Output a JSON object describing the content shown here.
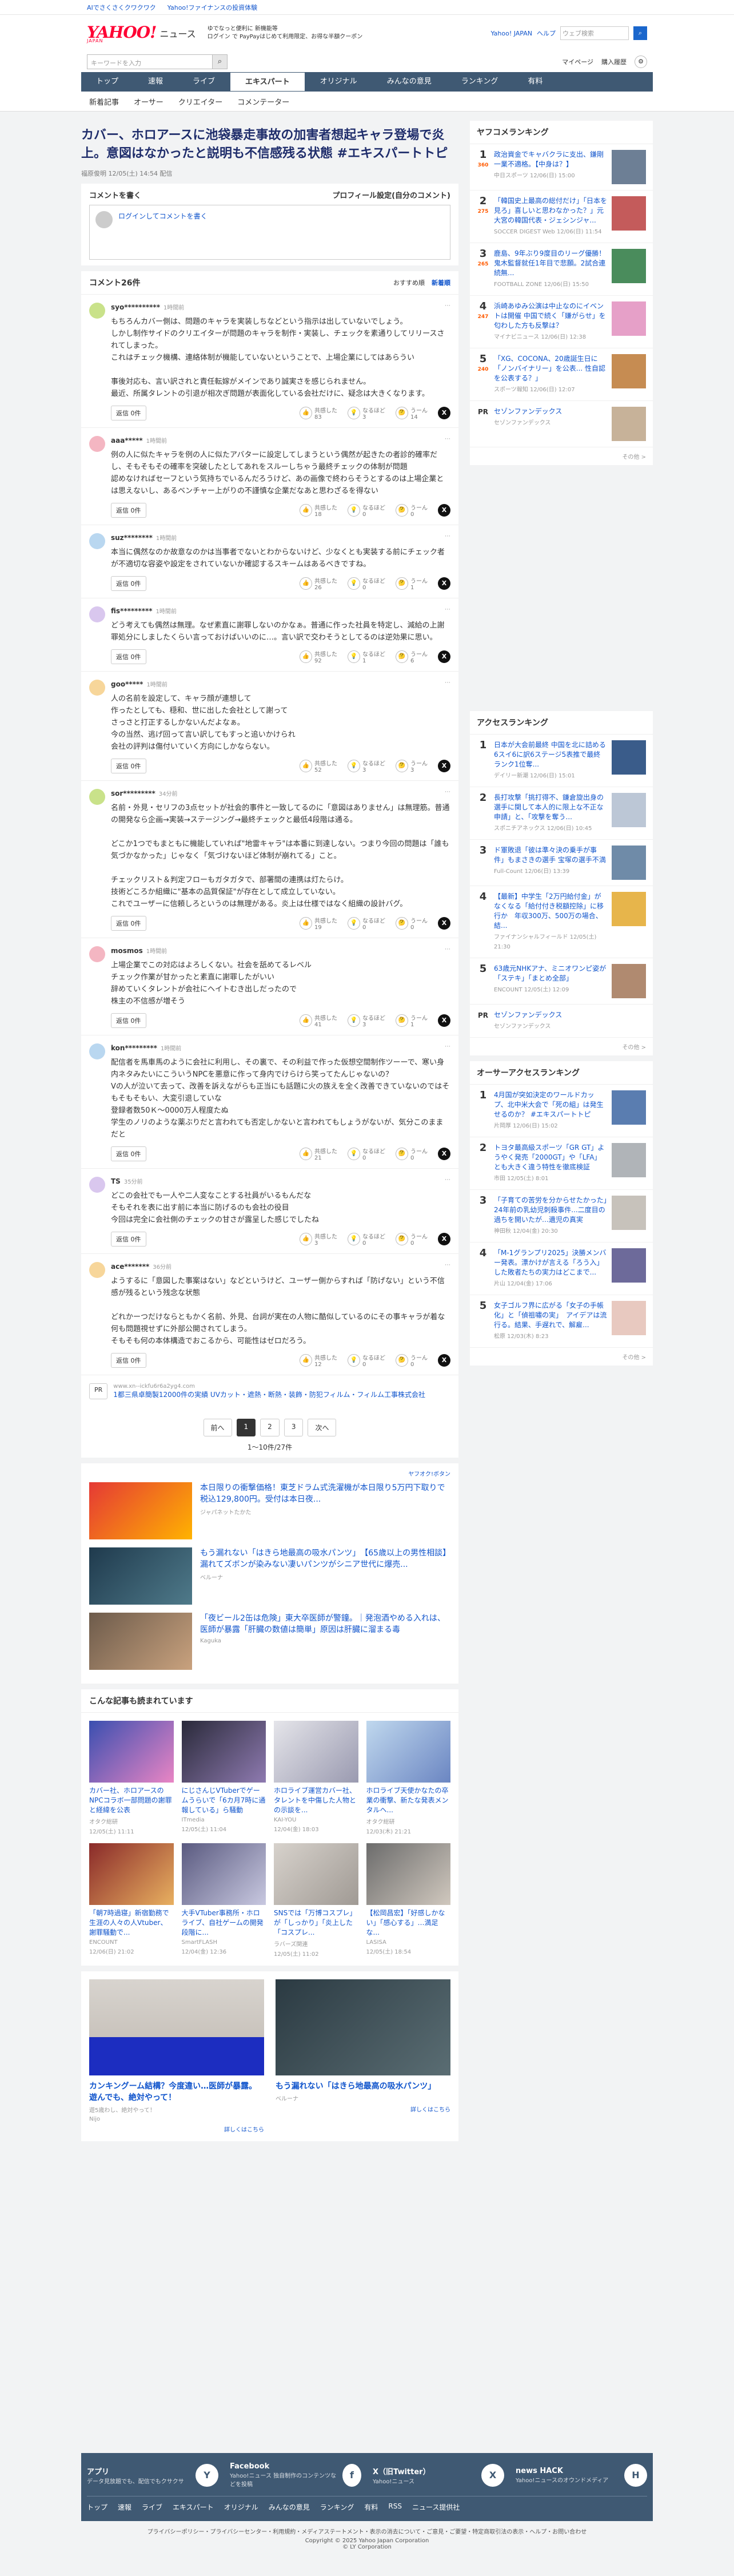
{
  "promo": [
    "AIでさくさくクワクワク",
    "Yahoo!ファイナンスの投資体験"
  ],
  "header": {
    "logo": "YAHOO!",
    "logo_sub": "JAPAN",
    "service": "ニュース",
    "promo_line1": "ゆでなっと便利に 新機能等",
    "promo_line2": "ログイン で PayPayはじめて利用限定、お得な半額クーポン",
    "links": [
      "Yahoo! JAPAN",
      "ヘルプ"
    ],
    "search_placeholder": "ウェブ検索"
  },
  "searchbar": {
    "placeholder": "キーワードを入力",
    "right": [
      "マイページ",
      "購入履歴"
    ]
  },
  "nav": [
    "トップ",
    "速報",
    "ライブ",
    "エキスパート",
    "オリジナル",
    "みんなの意見",
    "ランキング",
    "有料"
  ],
  "nav_active": "エキスパート",
  "subnav": [
    "新着記事",
    "オーサー",
    "クリエイター",
    "コメンテーター"
  ],
  "article": {
    "title": "カバー、ホロアースに池袋暴走事故の加害者想起キャラ登場で炎上。意図はなかったと説明も不信感残る状態 #エキスパートトピ",
    "meta": "福原俊明 12/05(土) 14:54 配信"
  },
  "comment_write": {
    "title": "コメントを書く",
    "profile_link": "プロフィール設定(自分のコメント)",
    "placeholder": "ログインしてコメントを書く"
  },
  "comments_header": {
    "title": "コメント26件",
    "sort": [
      "おすすめ順",
      "新着順"
    ]
  },
  "comments": [
    {
      "user": "syo**********",
      "time": "1時間前",
      "text": "もちろんカバー側は、問題のキャラを実装しちなどという指示は出していないでしょう。\nしかし制作サイドのクリエイターが問題のキャラを制作・実装し、チェックを素通りしてリリースされてしまった。\nこれはチェック機構、連絡体制が機能していないということで、上場企業にしてはあらうい\n\n事後対応も、言い訳されと責任転嫁がメインであり誠実さを感じられません。\n最近、所属タレントの引退が相次ぎ問題が表面化している会社だけに、疑念は大きくなります。",
      "reply": "返信 0件",
      "r1": "共感した\n83",
      "r2": "なるほど\n3",
      "r3": "うーん\n14"
    },
    {
      "user": "aaa*****",
      "time": "1時間前",
      "text": "例の人に似たキャラを例の人に似たアバターに設定してしまうという偶然が起きたの者診的確率だし、そもそもその確率を突破したとしてあれをスルーしちゃう最終チェックの体制が問題\n認めなければセーフという気持ちでいるんだろうけど、あの画像で終わらそうとするのは上場企業とは思えないし、あるベンチャー上がりの不謹慎な企業だなあと思わざるを得ない",
      "reply": "返信 0件",
      "r1": "共感した\n18",
      "r2": "なるほど\n0",
      "r3": "うーん\n0"
    },
    {
      "user": "suz********",
      "time": "1時間前",
      "text": "本当に偶然なのか故意なのかは当事者でないとわからないけど、少なくとも実装する前にチェック者が不適切な容姿や設定をされていないか確認するスキームはあるべきですね。",
      "reply": "返信 0件",
      "r1": "共感した\n26",
      "r2": "なるほど\n0",
      "r3": "うーん\n1"
    },
    {
      "user": "fis*********",
      "time": "1時間前",
      "text": "どう考えても偶然は無理。なぜ素直に謝罪しないのかなぁ。普通に作った社員を特定し、減給の上謝罪処分にしましたくらい言っておけばいいのに…。言い訳で交わそうとしてるのは逆効果に思い。",
      "reply": "返信 0件",
      "r1": "共感した\n92",
      "r2": "なるほど\n1",
      "r3": "うーん\n6"
    },
    {
      "user": "goo*****",
      "time": "1時間前",
      "text": "人の名前を設定して、キャラ顔が連想して\n作ったとしても、穏和、世に出した会社として謝って\nさっさと打正するしかないんだよなぁ。\n今の当然、逃げ回って言い訳してもすっと追いかけられ\n会社の評判は傷付いていく方向にしかならない。",
      "reply": "返信 0件",
      "r1": "共感した\n52",
      "r2": "なるほど\n3",
      "r3": "うーん\n3"
    },
    {
      "user": "sor*********",
      "time": "34分前",
      "text": "名前・外見・セリフの3点セットが社会的事件と一致してるのに「意図はありません」は無理筋。普通の開発なら企画→実装→ステージング→最終チェックと最低4段階は通る。\n\nどこか1つでもまともに機能していれば\"地雷キャラ\"は本番に到達しない。つまり今回の問題は「誰も気づかなかった」じゃなく「気づけないほど体制が崩れてる」こと。\n\nチェックリスト＆判定フローもガタガタで、部署間の連携は灯たらけ。\n技術どころか組織に\"基本の品質保証\"が存在として成立していない。\nこれでユーザーに信頼しろというのは無理がある。炎上は仕様ではなく組織の設計バグ。",
      "reply": "返信 0件",
      "r1": "共感した\n19",
      "r2": "なるほど\n0",
      "r3": "うーん\n0"
    },
    {
      "user": "mosmos",
      "time": "1時間前",
      "text": "上場企業でこの対応はよろしくない。社会を舐めてるレベル\nチェック作業が甘かったと素直に謝罪したがいい\n辞めていくタレントが会社にヘイトむき出しだったので\n株主の不信感が増そう",
      "reply": "返信 0件",
      "r1": "共感した\n41",
      "r2": "なるほど\n3",
      "r3": "うーん\n1"
    },
    {
      "user": "kon*********",
      "time": "1時間前",
      "text": "配信者を馬車馬のように会社に利用し、その裏で、その利益で作った仮想空間制作ツーーで、寒い身内ネタみたいにこういうNPCを悪意に作って身内でけらけら笑ってたんじゃないの？\nVの人が泣いて去って、改善を訴えながらも正当にも話題に火の族えを全く改善できていないのではそもそもそもい、大変引退していな\n登録者数50Ｋ～0000万人程度たぬ\n学生のノリのような薬ぶりだと言われても否定しかないと言われてもしょうがないが、気分このままだと",
      "reply": "返信 0件",
      "r1": "共感した\n21",
      "r2": "なるほど\n0",
      "r3": "うーん\n0"
    },
    {
      "user": "TS",
      "time": "35分前",
      "text": "どこの会社でも一人や二人変なことする社員がいるもんだな\nそもそれを表に出す前に本当に防げるのも会社の役目\n今回は完全に会社側のチェックの甘さが露呈した感じでしたね",
      "reply": "返信 0件",
      "r1": "共感した\n3",
      "r2": "なるほど\n0",
      "r3": "うーん\n0"
    },
    {
      "user": "ace*******",
      "time": "36分前",
      "text": "ようするに「意図した事案はない」などというけど、ユーザー側からすれば「防げない」という不信感が残るという残念な状態\n\nどれかーつだけならともかく名前、外見、台詞が実在の人物に酷似しているのにその事キャラが着な何も問題視せずに外部公開されてしまう。\nそもそも何の本体構造でおこるから、可能性はゼロだろう。",
      "reply": "返信 0件",
      "r1": "共感した\n12",
      "r2": "なるほど\n0",
      "r3": "うーん\n0"
    }
  ],
  "inline_ad": {
    "label": "PR",
    "source": "www.xn--ickfu6r6a2yg4.com",
    "text": "1都三県卓簡製12000件の実績 UVカット・遮熱・断熱・装飾・防犯フィルム・フィルム工事株式会社"
  },
  "pager": {
    "prev": "前へ",
    "pages": [
      "1",
      "2",
      "3"
    ],
    "next": "次へ",
    "active": "1",
    "count": "1〜10件/27件"
  },
  "ad_label": "ヤフオク!ボタン",
  "ads": [
    {
      "title": "本日限りの衝撃価格！東芝ドラム式洗濯機が本日限り5万円下取りで税込129,800円。受付は本日夜...",
      "source": "ジャパネットたかた"
    },
    {
      "title": "もう漏れない「はきら地最高の吸水パンツ」　【65歳以上の男性相談】漏れてズボンが染みない凄いパンツがシニア世代に爆売...",
      "source": "ベルーナ"
    },
    {
      "title": "「夜ビール2缶は危険」東大卒医師が警鐘。｜発泡酒やめる入れは、医師が暴露「肝臓の数値は簡単」原因は肝臓に溜まる毒",
      "source": "Kaguka"
    }
  ],
  "also_read": {
    "title": "こんな記事も読まれています",
    "items": [
      {
        "title": "カバー社、ホロアースのNPCコラボ一部問題の謝罪と経緯を公表",
        "source": "オタク総研",
        "date": "12/05(土) 11:11"
      },
      {
        "title": "にじさんじVTuberでゲームうらいで「6カ月7時に通報している」ら騒動",
        "source": "ITmedia",
        "date": "12/05(土) 11:04"
      },
      {
        "title": "ホロライブ運営カバー社、タレントを中傷した人物との示談を...",
        "source": "KAI-YOU",
        "date": "12/04(金) 18:03"
      },
      {
        "title": "ホロライブ天使かなたの卒業の衝撃、新たな発表メンタルヘ...",
        "source": "オタク総研",
        "date": "12/03(木) 21:21"
      },
      {
        "title": "「朝7時過寝」新宿勤務で生涯の人々の人Vtuber、謝罪騒動で...",
        "source": "ENCOUNT",
        "date": "12/06(日) 21:02"
      },
      {
        "title": "大手VTuber事務所・ホロライブ、自社ゲームの開発段階に...",
        "source": "SmartFLASH",
        "date": "12/04(金) 12:36"
      },
      {
        "title": "SNSでは「万博コスプレ」が「しっかり」「炎上した「コスプレ...",
        "source": "ラバーズ関連",
        "date": "12/05(土) 11:02"
      },
      {
        "title": "【松岡昌宏】「好感しかない」「感心する」…満足な...",
        "source": "LASISA",
        "date": "12/05(土) 18:54"
      }
    ]
  },
  "bottom_ads": [
    {
      "title": "カンキングーム結構？今度違い…医師が暴露。遊んでも、絶対やって！",
      "banner": "遊5歳わし、絶対やって！",
      "source": "Nijo",
      "more": "詳しくはこちら"
    },
    {
      "title": "もう漏れない「はきら地最高の吸水パンツ」",
      "source": "ベルーナ",
      "more": "詳しくはこちら"
    }
  ],
  "ranking": {
    "title": "ヤフコメランキング",
    "items": [
      {
        "rank": "1",
        "count": "360",
        "title": "政治資金でキャバクラに支出、鎌剛一業不適格。【中身は？】",
        "source": "中日スポーツ 12/06(日) 15:00"
      },
      {
        "rank": "2",
        "count": "275",
        "title": "「韓国史上最高の総付だけ」「日本を見ろ」喜しいと思わなかった？」元大宮の韓国代表・ジェシンジャ...",
        "source": "SOCCER DIGEST Web 12/06(日) 11:54"
      },
      {
        "rank": "3",
        "count": "265",
        "title": "鹿島、9年ぶり9度目のリーグ優勝！ 鬼木監督就任1年目で悲願。2試合連続無...",
        "source": "FOOTBALL ZONE 12/06(日) 15:50"
      },
      {
        "rank": "4",
        "count": "247",
        "title": "浜崎あゆみ公演は中止なのにイベントは開催 中国で続く「嫌がらせ」を匂わした方も反撃は？",
        "source": "マイナビニュース 12/06(日) 12:38"
      },
      {
        "rank": "5",
        "count": "240",
        "title": "「XG、COCONA、20歳誕生日に「ノンバイナリー」を公表... 性自認を公表する？」",
        "source": "スポーツ報知 12/06(日) 12:07"
      }
    ],
    "pr": {
      "label": "PR",
      "title": "セゾンファンデックス",
      "source": "セゾンファンデックス"
    }
  },
  "access_ranking": {
    "title": "アクセスランキング",
    "items": [
      {
        "rank": "1",
        "title": "日本が大会前最終 中国を北に詰める6スイ6に訳6ステージ5表推で最終ランク1位奪...",
        "source": "デイリー新潮 12/06(日) 15:01"
      },
      {
        "rank": "2",
        "title": "長打攻撃「挑打得不、鎌倉旋出身の選手に関して本人的に限上な不正な申請」と、「攻撃を奪う...",
        "source": "スポニチアネックス 12/06(日) 10:45"
      },
      {
        "rank": "3",
        "title": "ド軍敗退「彼は準々決の乗手が事件」もまさきの選手 宝塚の選手不満",
        "source": "Full-Count 12/06(日) 13:39"
      },
      {
        "rank": "4",
        "title": "【最新】中学生「2万円給付金」がなくなる「給付付き税額控除」に移行か　年収300万、500万の場合、結...",
        "source": "ファイナンシャルフィールド 12/05(土) 21:30"
      },
      {
        "rank": "5",
        "title": "63歳元NHKアナ、ミニオワンピ姿が「ステキ」「まとめ全部」",
        "source": "ENCOUNT 12/05(土) 12:09"
      }
    ],
    "pr": {
      "label": "PR",
      "title": "セゾンファンデックス",
      "source": "セゾンファンデックス"
    }
  },
  "expert_ranking": {
    "title": "オーサーアクセスランキング",
    "items": [
      {
        "rank": "1",
        "title": "4月国が突如決定のワールドカップ、北中米大会で「死の組」は発生せるのか？ #エキスパートトピ",
        "source": "片岡厚 12/06(日) 15:02"
      },
      {
        "rank": "2",
        "title": "トヨタ最高級スポーツ「GR GT」ようやく発売「2000GT」や「LFA」とも大きく違う特性を徹底検証",
        "source": "市田 12/05(土) 8:01"
      },
      {
        "rank": "3",
        "title": "「子育ての苦労を分からせたかった」24年前の乳幼児刺殺事件...二度目の過ちを開いたが…遺児の真実",
        "source": "神田秋 12/04(金) 20:30"
      },
      {
        "rank": "4",
        "title": "「M-1グランプリ2025」決勝メンバー発表。漂かけが言える「ろう入」した敗者たちの実力はどこまで...",
        "source": "片山 12/04(金) 17:06"
      },
      {
        "rank": "5",
        "title": "女子ゴルフ界に広がる「女子の手帳化」と「偵祖嘯の実」　アイデアは流行る。結果、手遅れで、解雇...",
        "source": "松原 12/03(木) 8:23"
      }
    ]
  },
  "sidebar_more": "その他 >",
  "footer": {
    "apps": [
      {
        "title": "アプリ",
        "sub": "データ見放題でも、配信でもクサクサ",
        "icon": "Y"
      },
      {
        "title": "Facebook",
        "sub": "Yahoo!ニュース 独自制作のコンテンツなどを投稿",
        "icon": "f"
      },
      {
        "title": "X（旧Twitter）",
        "sub": "Yahoo!ニュース",
        "icon": "X"
      },
      {
        "title": "news HACK",
        "sub": "Yahoo!ニュースのオウンドメディア",
        "icon": "H"
      }
    ],
    "nav": [
      "トップ",
      "速報",
      "ライブ",
      "エキスパート",
      "オリジナル",
      "みんなの意見",
      "ランキング",
      "有料",
      "RSS",
      "ニュース提供社"
    ],
    "links": "プライバシーポリシー・プライバシーセンター・利用規約・メディアステートメント・表示の消去について・ご意見・ご要望・特定商取引法の表示・ヘルプ・お問い合わせ",
    "copyright": "Copyright © 2025 Yahoo Japan Corporation",
    "corp": "© LY Corporation"
  }
}
